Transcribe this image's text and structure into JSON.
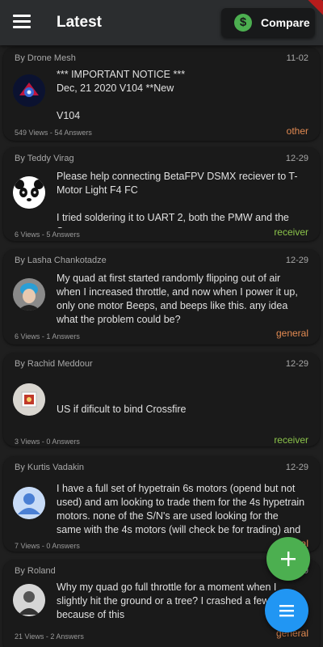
{
  "appbar": {
    "title": "Latest",
    "compare_label": "Compare",
    "compare_icon": "dollar-circle-icon",
    "menu_icon": "hamburger-menu-icon"
  },
  "posts": [
    {
      "author": "By Drone Mesh",
      "date": "11-02",
      "body": "*** IMPORTANT NOTICE ***\nDec, 21 2020 V104 **New\n\nV104",
      "stats": "549 Views - 54 Answers",
      "category": "other"
    },
    {
      "author": "By Teddy Virag",
      "date": "12-29",
      "body": "Please help connecting BetaFPV DSMX reciever to T-Motor Light F4 FC\n\nI tried soldering it to UART 2, both the PMW and the S-…",
      "stats": "6 Views - 5 Answers",
      "category": "receiver"
    },
    {
      "author": "By Lasha Chankotadze",
      "date": "12-29",
      "body": "My quad at first started randomly flipping out of air when I increased throttle, and now when I power it up, only one motor Beeps, and beeps like this. any idea what the problem could be?",
      "stats": "6 Views - 1 Answers",
      "category": "general"
    },
    {
      "author": "By Rachid Meddour",
      "date": "12-29",
      "body": "US if dificult to bind Crossfire",
      "stats": "3 Views - 0 Answers",
      "category": "receiver"
    },
    {
      "author": "By Kurtis Vadakin",
      "date": "12-29",
      "body": "I have a full set of hypetrain 6s motors (opend but not used) and am looking to trade them for the 4s hypetrain motors. none of the S/N's are used looking for the same with the 4s motors (will check be for trading) and to …",
      "stats": "7 Views - 0 Answers",
      "category": "general"
    },
    {
      "author": "By Roland",
      "date": "12-29",
      "body": "Why my quad go full throttle for a moment when I slightly hit the ground or a tree? I crashed a few times because of this",
      "stats": "21 Views - 2 Answers",
      "category": "general"
    }
  ],
  "fabs": {
    "add_icon": "plus-icon",
    "menu_icon": "list-menu-icon"
  },
  "colors": {
    "background": "#1f1f1f",
    "card": "#1a1a1a",
    "appbar": "#2b2d2f",
    "green": "#4caf50",
    "blue": "#2196f3",
    "orange": "#e28a52",
    "lime": "#8bc34a"
  }
}
